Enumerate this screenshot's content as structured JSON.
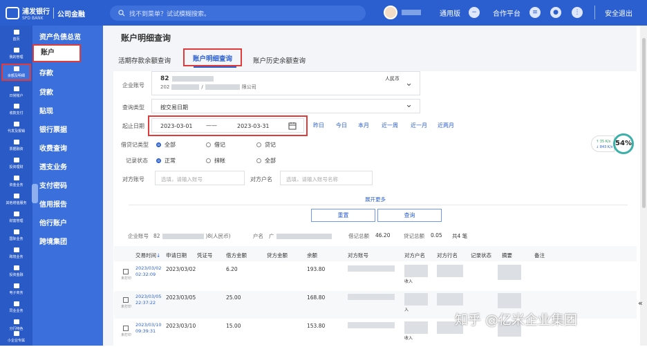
{
  "topbar": {
    "logo_cn": "浦发银行",
    "logo_en": "SPD BANK",
    "logo_sub": "公司金融",
    "search_placeholder": "找不到菜单？试试模糊搜索。",
    "version": "通用版",
    "platform": "合作平台",
    "logout": "安全退出"
  },
  "sidebar_icons": [
    "首页",
    "我的管理",
    "余额及明细",
    "日常账户",
    "收款支付",
    "代发及报销",
    "票据融资",
    "投资理财",
    "资金业务",
    "其他增值服务",
    "财富管理",
    "国际业务",
    "跨境业务",
    "投资金融",
    "电子商务",
    "同业业务",
    "分行特色",
    "小企业专属"
  ],
  "submenu": [
    {
      "label": "资产负债总览"
    },
    {
      "label": "账户"
    },
    {
      "label": "存款",
      "caret": "▾"
    },
    {
      "label": "贷款"
    },
    {
      "label": "贴现"
    },
    {
      "label": "银行票据",
      "caret": "▾"
    },
    {
      "label": "收费查询"
    },
    {
      "label": "透支业务"
    },
    {
      "label": "支付密码"
    },
    {
      "label": "信用报告"
    },
    {
      "label": "他行账户"
    },
    {
      "label": "跨境集团"
    }
  ],
  "page": {
    "title": "账户明细查询",
    "tabs": [
      "活期存款余额查询",
      "账户明细查询",
      "账户历史余额查询"
    ]
  },
  "form": {
    "account_label": "企业账号",
    "account_no_prefix": "82",
    "account_name_prefix": "202",
    "account_name_suffix": "限公司",
    "currency": "人民币",
    "query_type_label": "查询类型",
    "query_type_value": "按交易日期",
    "date_label": "起止日期",
    "date_start": "2023-03-01",
    "date_sep": "——",
    "date_end": "2023-03-31",
    "quick_dates": [
      "昨日",
      "今日",
      "本月",
      "近一周",
      "近一月",
      "近两月"
    ],
    "dc_label": "借贷记类型",
    "dc_options": [
      "全部",
      "借记",
      "贷记"
    ],
    "status_label": "记录状态",
    "status_options": [
      "正常",
      "抹帐",
      "全部"
    ],
    "cp_account_label": "对方账号",
    "cp_account_placeholder": "选填，请输入账号",
    "cp_name_label": "对方户名",
    "cp_name_placeholder": "选填，请输入账号名称",
    "expand": "展开更多",
    "reset": "重置",
    "query": "查询"
  },
  "summary": {
    "acct_label": "企业账号",
    "acct_prefix": "82",
    "acct_suffix": ")8(人民币)",
    "name_label": "户名",
    "name_prefix": "广",
    "debit_label": "借记总额",
    "debit_value": "46.20",
    "credit_label": "贷记总额",
    "credit_value": "0.05",
    "count_text": "共4 笔"
  },
  "table": {
    "headers": [
      "交易时间",
      "申请日期",
      "凭证号",
      "借方金额",
      "贷方金额",
      "余额",
      "对方账号",
      "对方户名",
      "对方行名",
      "记录状态",
      "摘要",
      "备注"
    ],
    "sort_icon": "↓",
    "unprinted": "未打印",
    "rows": [
      {
        "trade_date": "2023/03/02",
        "trade_time": "02:32:09",
        "apply_date": "2023/03/02",
        "debit": "6.20",
        "balance": "193.80",
        "cp_name_tail": "收入"
      },
      {
        "trade_date": "2023/03/05",
        "trade_time": "22:37:22",
        "apply_date": "2023/03/05",
        "debit": "25.00",
        "balance": "168.80",
        "cp_name_tail": "入"
      },
      {
        "trade_date": "2023/03/10",
        "trade_time": "09:39:31",
        "apply_date": "2023/03/10",
        "debit": "15.00",
        "balance": "153.80",
        "cp_name_tail": "收入"
      }
    ]
  },
  "widgets": {
    "gauge": "54%",
    "net_up": "↑ 35 K/s",
    "net_down": "↓ 843 K/s",
    "watermark": "知乎 @亿米企业集团",
    "collapse": "«"
  },
  "colors": {
    "brand": "#2b5fd0",
    "highlight": "#e03a3a"
  }
}
